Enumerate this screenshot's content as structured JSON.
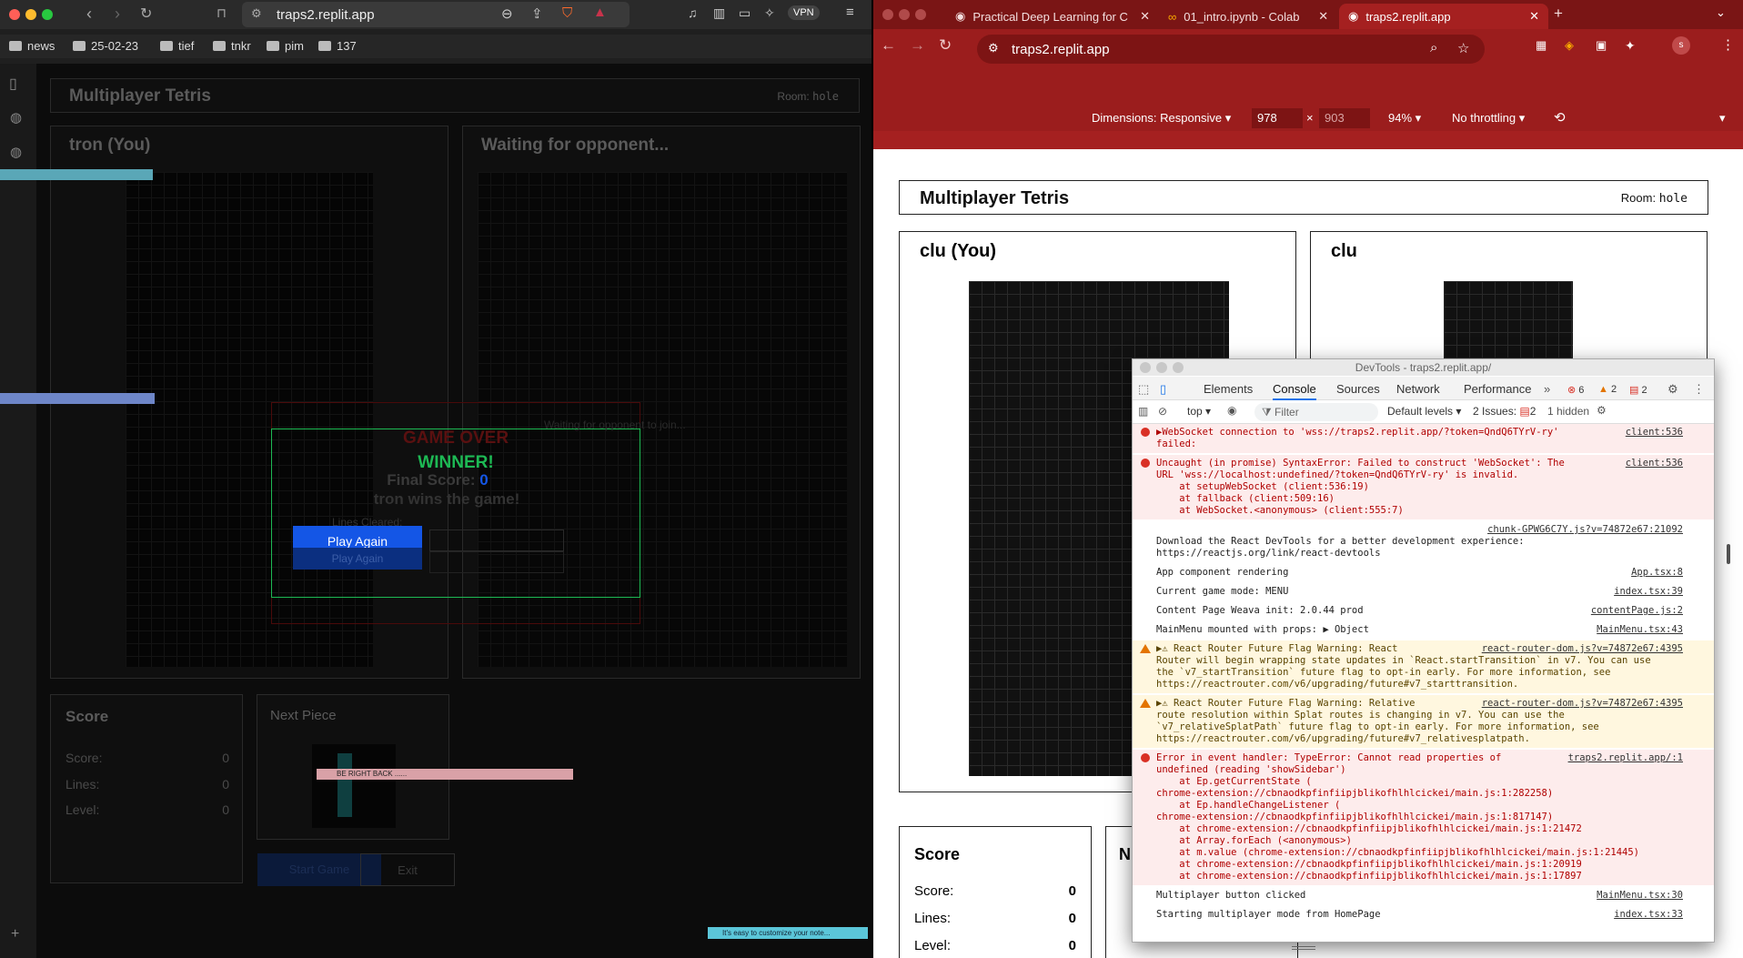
{
  "left_browser": {
    "url": "traps2.replit.app",
    "vpn": "VPN",
    "bookmarks": [
      "news",
      "25-02-23",
      "tief",
      "tnkr",
      "pim",
      "137"
    ],
    "app": {
      "title": "Multiplayer Tetris",
      "room_label": "Room:",
      "room_code": "hole",
      "player_board_title": "tron (You)",
      "opponent_board_title": "Waiting for opponent...",
      "game_over": "GAME OVER",
      "winner": "WINNER!",
      "final_score_label": "Final Score:",
      "final_score_value": "0",
      "win_message": "tron wins the game!",
      "waiting_join": "Waiting for opponent to join...",
      "lines_cleared": "Lines Cleared:",
      "play_again_primary": "Play Again",
      "play_again_secondary": "Play Again",
      "score_panel_title": "Score",
      "score_label": "Score:",
      "score_value": "0",
      "lines_label": "Lines:",
      "lines_value": "0",
      "level_label": "Level:",
      "level_value": "0",
      "next_piece_title": "Next Piece",
      "start_game": "Start Game",
      "exit": "Exit",
      "brb_note": "BE RIGHT BACK ......",
      "customize_note": "It's easy to customize your note..."
    }
  },
  "right_browser": {
    "tabs": [
      {
        "label": "Practical Deep Learning for C",
        "active": false
      },
      {
        "label": "01_intro.ipynb - Colab",
        "active": false
      },
      {
        "label": "traps2.replit.app",
        "active": true
      }
    ],
    "url": "traps2.replit.app",
    "device_toolbar": {
      "dimensions": "Dimensions: Responsive",
      "width": "978",
      "height": "903",
      "zoom": "94%",
      "throttling": "No throttling"
    },
    "app": {
      "title": "Multiplayer Tetris",
      "room_label": "Room:",
      "room_code": "hole",
      "player_board_title": "clu (You)",
      "opponent_board_title": "clu",
      "score_panel_title": "Score",
      "score_label": "Score:",
      "score_value": "0",
      "lines_label": "Lines:",
      "lines_value": "0",
      "level_label": "Level:",
      "level_value": "0",
      "next_partial": "N"
    },
    "devtools": {
      "window_title": "DevTools - traps2.replit.app/",
      "tabs": [
        "Elements",
        "Console",
        "Sources",
        "Network",
        "Performance"
      ],
      "active_tab": "Console",
      "error_count": "6",
      "warning_count": "2",
      "info_count": "2",
      "context": "top",
      "filter_placeholder": "Filter",
      "levels": "Default levels",
      "issues_label": "2 Issues:",
      "issues_count": "2",
      "hidden": "1 hidden",
      "console_lines": [
        {
          "type": "err",
          "text": "▶WebSocket connection to 'wss://traps2.replit.app/?token=QndQ6TYrV-ry'\nfailed:",
          "src": "client:536"
        },
        {
          "type": "err",
          "text": "Uncaught (in promise) SyntaxError: Failed to construct 'WebSocket': The\nURL 'wss://localhost:undefined/?token=QndQ6TYrV-ry' is invalid.\n    at setupWebSocket (client:536:19)\n    at fallback (client:509:16)\n    at WebSocket.<anonymous> (client:555:7)",
          "src": "client:536"
        },
        {
          "type": "log",
          "text": "\nDownload the React DevTools for a better development experience:\nhttps://reactjs.org/link/react-devtools",
          "src": "chunk-GPWG6C7Y.js?v=74872e67:21092"
        },
        {
          "type": "log",
          "text": "App component rendering",
          "src": "App.tsx:8"
        },
        {
          "type": "log",
          "text": "Current game mode: MENU",
          "src": "index.tsx:39"
        },
        {
          "type": "log",
          "text": "Content Page Weava init: 2.0.44 prod",
          "src": "contentPage.js:2"
        },
        {
          "type": "log",
          "text": "MainMenu mounted with props: ▶ Object",
          "src": "MainMenu.tsx:43"
        },
        {
          "type": "warn",
          "text": "▶⚠ React Router Future Flag Warning: React\nRouter will begin wrapping state updates in `React.startTransition` in v7. You can use\nthe `v7_startTransition` future flag to opt-in early. For more information, see\nhttps://reactrouter.com/v6/upgrading/future#v7_starttransition.",
          "src": "react-router-dom.js?v=74872e67:4395"
        },
        {
          "type": "warn",
          "text": "▶⚠ React Router Future Flag Warning: Relative\nroute resolution within Splat routes is changing in v7. You can use the\n`v7_relativeSplatPath` future flag to opt-in early. For more information, see\nhttps://reactrouter.com/v6/upgrading/future#v7_relativesplatpath.",
          "src": "react-router-dom.js?v=74872e67:4395"
        },
        {
          "type": "err",
          "text": "Error in event handler: TypeError: Cannot read properties of\nundefined (reading 'showSidebar')\n    at Ep.getCurrentState (\nchrome-extension://cbnaodkpfinfiipjblikofhlhlcickei/main.js:1:282258)\n    at Ep.handleChangeListener (\nchrome-extension://cbnaodkpfinfiipjblikofhlhlcickei/main.js:1:817147)\n    at chrome-extension://cbnaodkpfinfiipjblikofhlhlcickei/main.js:1:21472\n    at Array.forEach (<anonymous>)\n    at m.value (chrome-extension://cbnaodkpfinfiipjblikofhlhlcickei/main.js:1:21445)\n    at chrome-extension://cbnaodkpfinfiipjblikofhlhlcickei/main.js:1:20919\n    at chrome-extension://cbnaodkpfinfiipjblikofhlhlcickei/main.js:1:17897",
          "src": "traps2.replit.app/:1"
        },
        {
          "type": "log",
          "text": "Multiplayer button clicked",
          "src": "MainMenu.tsx:30"
        },
        {
          "type": "log",
          "text": "Starting multiplayer mode from HomePage",
          "src": "index.tsx:33"
        }
      ]
    }
  },
  "colors": {
    "chrome_theme": "#9b1d1d",
    "play_again_blue": "#1456e6",
    "winner_green": "#1db954",
    "game_over_red": "#8b1a1a"
  }
}
